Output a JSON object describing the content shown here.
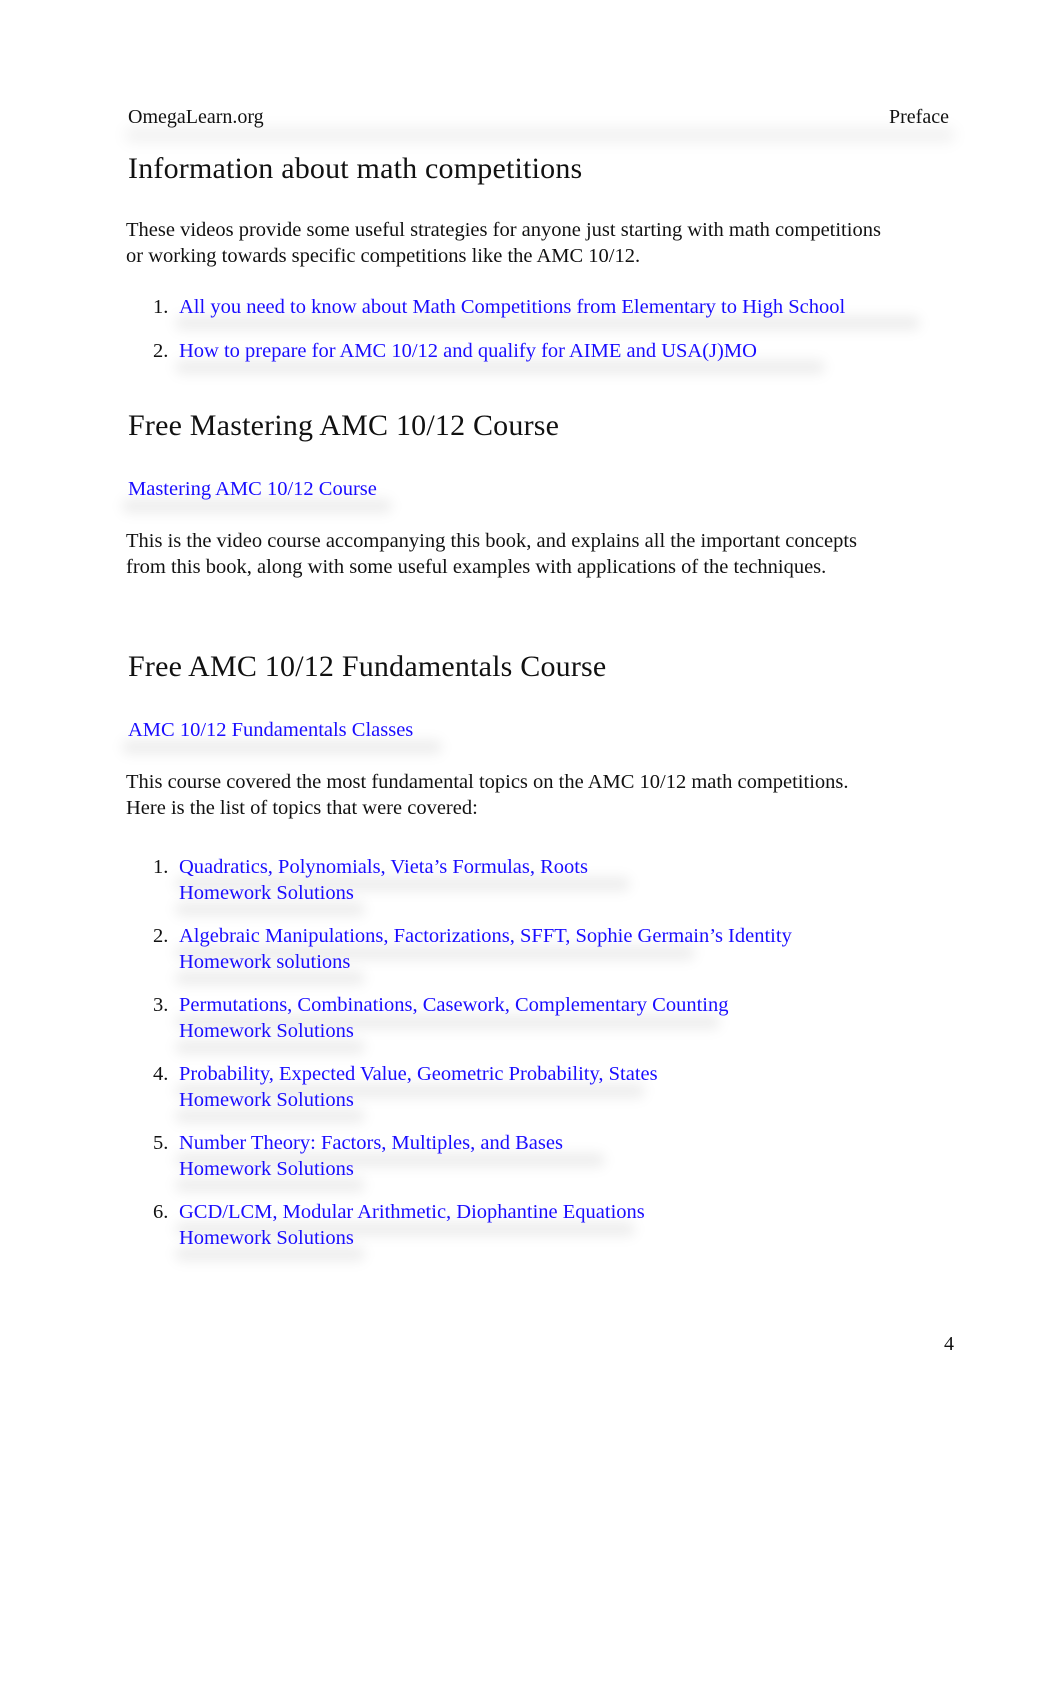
{
  "header": {
    "left": "OmegaLearn.org",
    "right": "Preface"
  },
  "section1": {
    "title": "Information about math competitions",
    "paragraph": [
      "These videos provide some useful strategies for anyone just starting with math competitions",
      "or working towards specific competitions like the AMC 10/12."
    ],
    "links": [
      {
        "num": "1.",
        "label": "All you need to know about Math Competitions from Elementary to High School"
      },
      {
        "num": "2.",
        "label": "How to prepare for AMC 10/12 and qualify for AIME and USA(J)MO"
      }
    ]
  },
  "section2": {
    "title": "Free Mastering AMC 10/12 Course",
    "link": "Mastering AMC 10/12 Course",
    "paragraph": [
      "This is the video course accompanying this book, and explains all the important concepts",
      "from this book, along with some useful examples with applications of the techniques."
    ]
  },
  "section3": {
    "title": "Free AMC 10/12 Fundamentals Course",
    "link": "AMC 10/12 Fundamentals Classes",
    "paragraph": [
      "This course covered the most fundamental topics on the AMC 10/12 math competitions.",
      "Here is the list of topics that were covered:"
    ],
    "topics": [
      {
        "num": "1.",
        "topic": "Quadratics, Polynomials, Vieta’s Formulas, Roots",
        "homework": "Homework Solutions"
      },
      {
        "num": "2.",
        "topic": "Algebraic Manipulations, Factorizations, SFFT, Sophie Germain’s Identity",
        "homework": "Homework solutions"
      },
      {
        "num": "3.",
        "topic": "Permutations, Combinations, Casework, Complementary Counting",
        "homework": "Homework Solutions"
      },
      {
        "num": "4.",
        "topic": "Probability, Expected Value, Geometric Probability, States",
        "homework": "Homework Solutions"
      },
      {
        "num": "5.",
        "topic": "Number Theory: Factors, Multiples, and Bases",
        "homework": "Homework Solutions"
      },
      {
        "num": "6.",
        "topic": "GCD/LCM, Modular Arithmetic, Diophantine Equations",
        "homework": "Homework Solutions"
      }
    ]
  },
  "footer": {
    "page_number": "4"
  }
}
